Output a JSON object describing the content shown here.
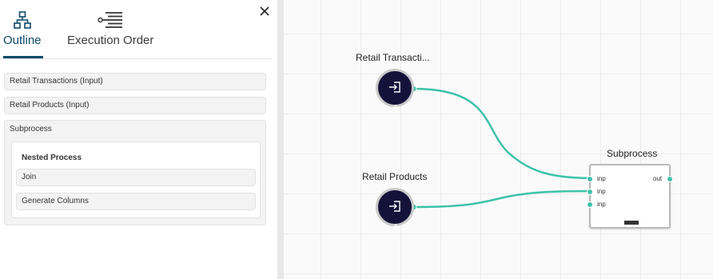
{
  "panel": {
    "tabs": [
      {
        "label": "Outline",
        "icon": "outline-tree-icon",
        "active": true
      },
      {
        "label": "Execution Order",
        "icon": "execution-order-icon",
        "active": false
      }
    ],
    "close_icon": "close-icon",
    "items": [
      {
        "label": "Retail Transactions (Input)"
      },
      {
        "label": "Retail Products (Input)"
      }
    ],
    "group": {
      "label": "Subprocess",
      "nested_title": "Nested Process",
      "items": [
        {
          "label": "Join"
        },
        {
          "label": "Generate Columns"
        }
      ]
    }
  },
  "canvas": {
    "nodes": [
      {
        "title": "Retail Transacti...",
        "icon": "input-icon"
      },
      {
        "title": "Retail Products",
        "icon": "input-icon"
      }
    ],
    "subprocess": {
      "title": "Subprocess",
      "inputs": [
        "inp",
        "inp",
        "inp"
      ],
      "output": "out"
    }
  },
  "colors": {
    "accent": "#0d4a6b",
    "node_fill": "#15123a",
    "wire": "#3ec2a9"
  }
}
